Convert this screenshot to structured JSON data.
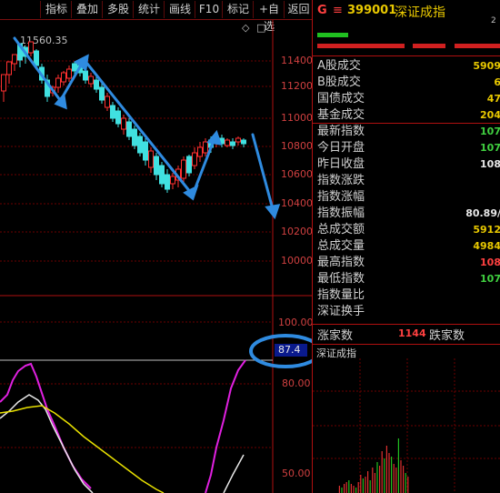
{
  "toolbar": {
    "buttons": [
      "指标",
      "叠加",
      "多股",
      "统计",
      "画线",
      "F10",
      "标记",
      "+自选",
      "返回"
    ]
  },
  "chart": {
    "high_label": "11560.35",
    "price_axis": [
      "11400",
      "11200",
      "11000",
      "10800",
      "10600",
      "10400",
      "10200",
      "10000"
    ],
    "indicator_axis": [
      "100.00",
      "80.00",
      "50.00"
    ],
    "indicator_value": "87.4",
    "diamond": "◇",
    "box": "□"
  },
  "panel": {
    "index_prefix": "G",
    "index_menu": "≡",
    "index_code": "399001",
    "index_name": "深证成指",
    "corner_value": "2",
    "rows": [
      {
        "label": "A股成交",
        "value": "5909",
        "color": "#e8c800"
      },
      {
        "label": "B股成交",
        "value": "6",
        "color": "#e8c800"
      },
      {
        "label": "国债成交",
        "value": "47",
        "color": "#e8c800"
      },
      {
        "label": "基金成交",
        "value": "204",
        "color": "#e8c800"
      },
      {
        "label": "最新指数",
        "value": "107",
        "color": "#40d040"
      },
      {
        "label": "今日开盘",
        "value": "107",
        "color": "#40d040"
      },
      {
        "label": "昨日收盘",
        "value": "108",
        "color": "#e8e8e8"
      },
      {
        "label": "指数涨跌",
        "value": "",
        "color": "#40d040"
      },
      {
        "label": "指数涨幅",
        "value": "",
        "color": "#40d040"
      },
      {
        "label": "指数振幅",
        "value": "80.89/",
        "color": "#e8e8e8"
      },
      {
        "label": "总成交额",
        "value": "5912",
        "color": "#e8c800"
      },
      {
        "label": "总成交量",
        "value": "4984",
        "color": "#e8c800"
      },
      {
        "label": "最高指数",
        "value": "108",
        "color": "#ff4040"
      },
      {
        "label": "最低指数",
        "value": "107",
        "color": "#40d040"
      },
      {
        "label": "指数量比",
        "value": "",
        "color": "#e8e8e8"
      },
      {
        "label": "深证换手",
        "value": "",
        "color": "#e8e8e8"
      }
    ],
    "rise_label": "涨家数",
    "rise_count": "1144",
    "fall_label": "跌家数",
    "mini_title": "深证成指"
  },
  "colors": {
    "up": "#ff3030",
    "down": "#40e0e0",
    "grid": "#6b0000",
    "annotation": "#2f8be0",
    "ma_white": "#e8e8e8",
    "ma_yellow": "#e8e000",
    "ma_magenta": "#e020e0"
  }
}
